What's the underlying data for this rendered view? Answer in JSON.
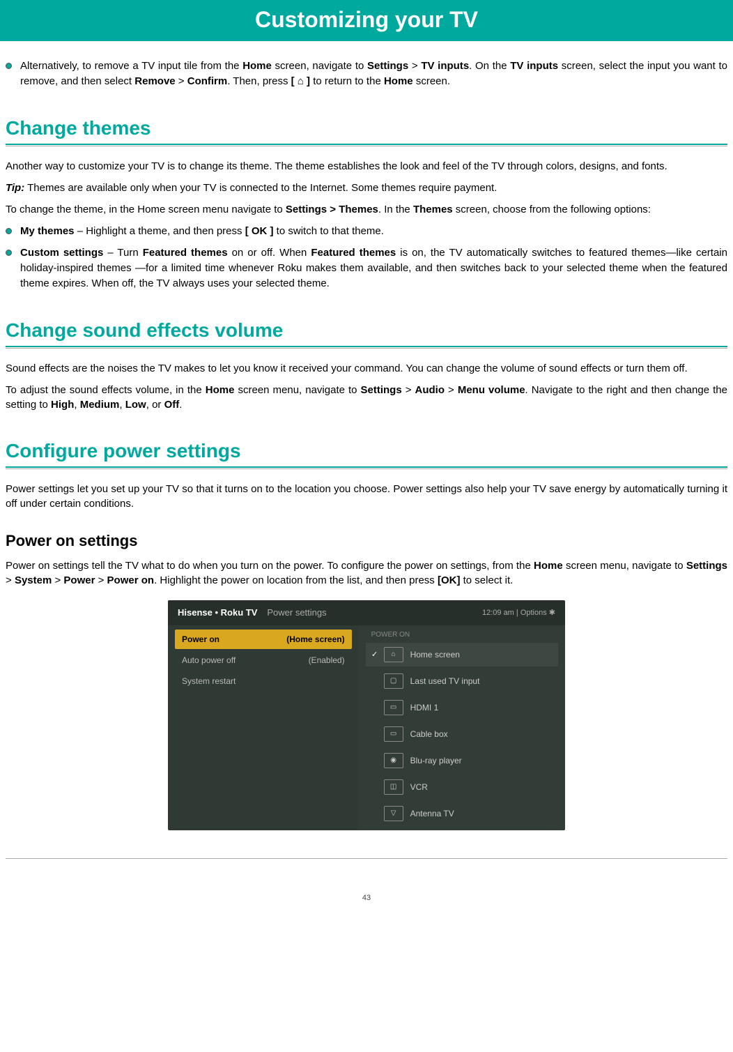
{
  "page_title": "Customizing your TV",
  "intro_bullet": {
    "prefix": "Alternatively, to remove a TV input tile from the ",
    "b1": "Home",
    "t1": " screen, navigate to ",
    "b2": "Settings",
    "t2": " > ",
    "b3": "TV inputs",
    "t3": ". On the ",
    "b4": "TV inputs",
    "t4": " screen, select the input you want to remove, and then select ",
    "b5": "Remove",
    "t5": " > ",
    "b6": "Confirm",
    "t6": ". Then, press ",
    "b7": "[ ⌂ ]",
    "t7": " to return to the ",
    "b8": "Home",
    "t8": " screen."
  },
  "sec1": {
    "heading": "Change themes",
    "p1": "Another way to customize your TV is to change its theme. The theme establishes the look and feel of the TV through colors, designs, and fonts.",
    "tip_label": "Tip:",
    "tip_body": " Themes are available only when your TV is connected to the Internet. Some themes require payment.",
    "p2a": "To change the theme, in the Home screen menu navigate to ",
    "p2b": "Settings > Themes",
    "p2c": ". In the ",
    "p2d": "Themes",
    "p2e": " screen, choose from the following options:",
    "bullet1": {
      "b": "My themes",
      "t1": " – Highlight a theme, and then press ",
      "b2": "[ OK ]",
      "t2": " to switch to that theme."
    },
    "bullet2": {
      "b": "Custom settings",
      "t1": " – Turn ",
      "b2": "Featured themes",
      "t2": " on or off. When ",
      "b3": "Featured themes",
      "t3": " is on, the TV automatically switches to featured themes—like certain holiday-inspired themes —for a limited time whenever Roku makes them available, and then switches back to your selected theme when the featured theme expires. When off, the TV always uses your selected theme."
    }
  },
  "sec2": {
    "heading": "Change sound effects volume",
    "p1": "Sound effects are the noises the TV makes to let you know it received your command. You can change the volume of sound effects or turn them off.",
    "p2a": "To adjust the sound effects volume, in the ",
    "p2b": "Home",
    "p2c": " screen menu, navigate to ",
    "p2d": "Settings",
    "p2e": " > ",
    "p2f": "Audio",
    "p2g": " > ",
    "p2h": "Menu volume",
    "p2i": ". Navigate to the right and then change the setting to ",
    "p2j": "High",
    "p2k": ", ",
    "p2l": "Medium",
    "p2m": ", ",
    "p2n": "Low",
    "p2o": ", or ",
    "p2p": "Off",
    "p2q": "."
  },
  "sec3": {
    "heading": "Configure power settings",
    "p1": "Power settings let you set up your TV so that it turns on to the location you choose. Power settings also help your TV save energy by automatically turning it off under certain conditions.",
    "sub": "Power on settings",
    "p2a": "Power on settings tell the TV what to do when you turn on the power. To configure the power on settings, from the ",
    "p2b": "Home",
    "p2c": " screen menu, navigate to ",
    "p2d": "Settings",
    "p2e": " > ",
    "p2f": "System",
    "p2g": " > ",
    "p2h": "Power",
    "p2i": " > ",
    "p2j": "Power on",
    "p2k": ". Highlight the power on location from the list, and then press ",
    "p2l": "[OK]",
    "p2m": " to select it."
  },
  "tvshot": {
    "brand": "Hisense • Roku TV",
    "breadcrumb": "Power settings",
    "time": "12:09 am   |   Options ✱",
    "left": [
      {
        "label": "Power on",
        "value": "(Home screen)",
        "active": true
      },
      {
        "label": "Auto power off",
        "value": "(Enabled)",
        "active": false
      },
      {
        "label": "System restart",
        "value": "",
        "active": false
      }
    ],
    "right_header": "POWER ON",
    "right": [
      {
        "icon": "⌂",
        "label": "Home screen",
        "active": true
      },
      {
        "icon": "▢",
        "label": "Last used TV input",
        "active": false
      },
      {
        "icon": "▭",
        "label": "HDMI 1",
        "active": false
      },
      {
        "icon": "▭",
        "label": "Cable box",
        "active": false
      },
      {
        "icon": "◉",
        "label": "Blu-ray player",
        "active": false
      },
      {
        "icon": "◫",
        "label": "VCR",
        "active": false
      },
      {
        "icon": "▽",
        "label": "Antenna TV",
        "active": false
      }
    ]
  },
  "page_number": "43"
}
